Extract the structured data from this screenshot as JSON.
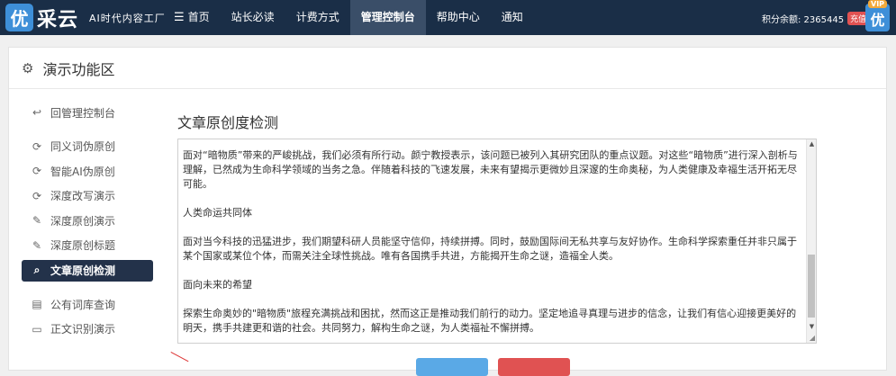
{
  "brand": {
    "badge": "优",
    "name": "采云",
    "subtitle": "AI时代内容工厂"
  },
  "nav": {
    "items": [
      {
        "label": "首页",
        "icon": "menu-icon"
      },
      {
        "label": "站长必读"
      },
      {
        "label": "计费方式"
      },
      {
        "label": "管理控制台",
        "active": true
      },
      {
        "label": "帮助中心"
      },
      {
        "label": "通知"
      }
    ]
  },
  "account": {
    "points_label": "积分余额: 2365445",
    "recharge_label": "充值",
    "avatar_glyph": "优",
    "vip_label": "VIP"
  },
  "panel": {
    "title": "演示功能区"
  },
  "sidebar": {
    "items": [
      {
        "label": "回管理控制台",
        "icon": "back-icon"
      },
      {
        "label": "同义词伪原创",
        "icon": "refresh-icon"
      },
      {
        "label": "智能AI伪原创",
        "icon": "refresh-icon"
      },
      {
        "label": "深度改写演示",
        "icon": "refresh-icon"
      },
      {
        "label": "深度原创演示",
        "icon": "edit-icon"
      },
      {
        "label": "深度原创标题",
        "icon": "edit-icon"
      },
      {
        "label": "文章原创检测",
        "icon": "search-icon",
        "active": true
      },
      {
        "label": "公有词库查询",
        "icon": "book-icon"
      },
      {
        "label": "正文识别演示",
        "icon": "monitor-icon"
      }
    ]
  },
  "content": {
    "title": "文章原创度检测",
    "paragraphs": [
      "面对“暗物质”带来的严峻挑战，我们必须有所行动。颜宁教授表示，该问题已被列入其研究团队的重点议题。对这些“暗物质”进行深入剖析与理解，已然成为生命科学领域的当务之急。伴随着科技的飞速发展，未来有望揭示更微妙且深邃的生命奥秘，为人类健康及幸福生活开拓无尽可能。",
      "人类命运共同体",
      "面对当今科技的迅猛进步，我们期望科研人员能坚守信仰，持续拼搏。同时，鼓励国际间无私共享与友好协作。生命科学探索重任并非只属于某个国家或某位个体，而需关注全球性挑战。唯有各国携手共进，方能揭开生命之谜，造福全人类。",
      "面向未来的希望",
      "探索生命奥妙的\"暗物质\"旅程充满挑战和困扰，然而这正是推动我们前行的动力。坚定地追寻真理与进步的信念，让我们有信心迎接更美好的明天，携手共建更和谐的社会。共同努力，解构生命之谜，为人类福祉不懈拼搏。"
    ]
  },
  "colors": {
    "topbar": "#1a2e47",
    "active_sidebar": "#23324a",
    "button_primary": "#5aa9e6",
    "button_danger": "#e05252"
  }
}
